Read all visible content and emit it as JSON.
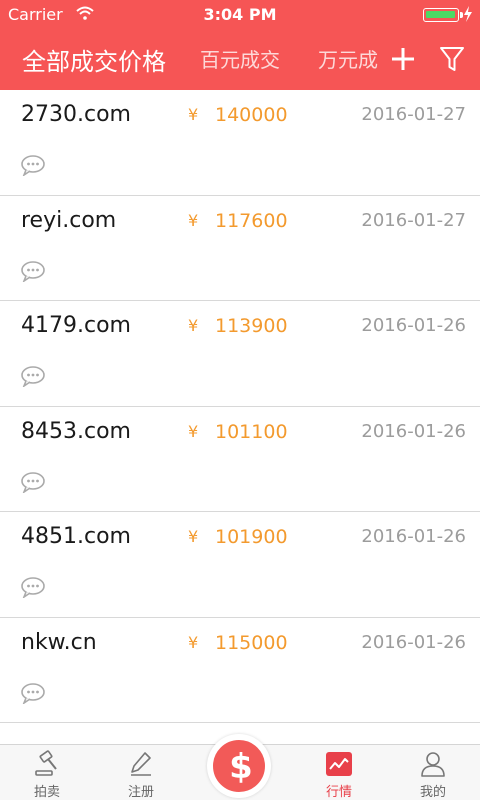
{
  "status_bar": {
    "carrier": "Carrier",
    "time": "3:04 PM",
    "battery_color": "#4cd964"
  },
  "nav": {
    "tabs": [
      {
        "label": "全部成交价格",
        "active": true
      },
      {
        "label": "百元成交",
        "active": false
      },
      {
        "label": "万元成",
        "active": false
      }
    ],
    "add_icon": "plus-icon",
    "filter_icon": "filter-icon"
  },
  "list": {
    "currency_symbol": "¥",
    "items": [
      {
        "domain": "2730.com",
        "price": "140000",
        "date": "2016-01-27"
      },
      {
        "domain": "reyi.com",
        "price": "117600",
        "date": "2016-01-27"
      },
      {
        "domain": "4179.com",
        "price": "113900",
        "date": "2016-01-26"
      },
      {
        "domain": "8453.com",
        "price": "101100",
        "date": "2016-01-26"
      },
      {
        "domain": "4851.com",
        "price": "101900",
        "date": "2016-01-26"
      },
      {
        "domain": "nkw.cn",
        "price": "115000",
        "date": "2016-01-26"
      }
    ]
  },
  "tabbar": {
    "items": [
      {
        "label": "拍卖",
        "icon": "gavel-icon",
        "active": false
      },
      {
        "label": "注册",
        "icon": "pen-icon",
        "active": false
      },
      {
        "label": "",
        "icon": "dollar-icon",
        "symbol": "$",
        "active": false
      },
      {
        "label": "行情",
        "icon": "trend-chart-icon",
        "active": true
      },
      {
        "label": "我的",
        "icon": "user-icon",
        "active": false
      }
    ]
  },
  "colors": {
    "brand_red": "#f65555",
    "price_orange": "#f39a2e",
    "date_gray": "#9c9c9c",
    "tab_active": "#e8404a"
  }
}
